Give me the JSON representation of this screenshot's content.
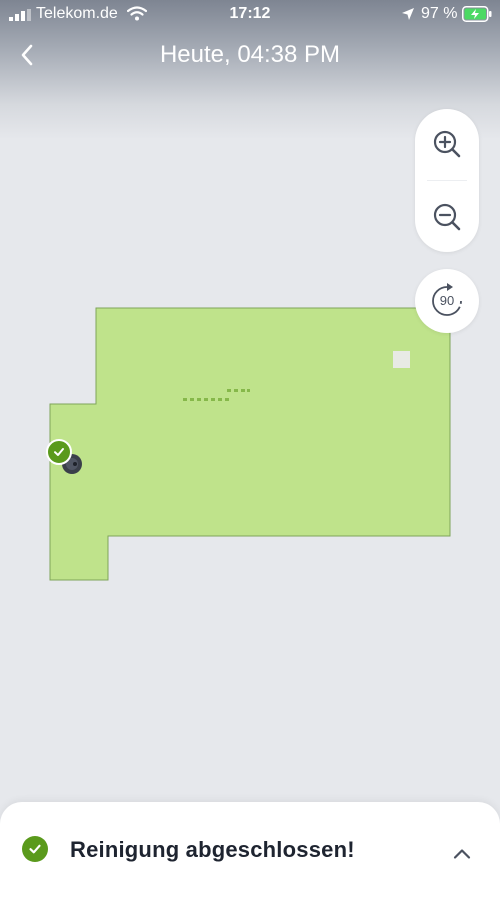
{
  "status_bar": {
    "carrier": "Telekom.de",
    "time": "17:12",
    "battery_percent": "97 %",
    "icons": [
      "signal-icon",
      "wifi-icon",
      "location-icon",
      "battery-charging-icon"
    ]
  },
  "nav": {
    "title": "Heute, 04:38 PM",
    "back_icon": "chevron-left-icon"
  },
  "map_controls": {
    "zoom_in_icon": "zoom-in-icon",
    "zoom_out_icon": "zoom-out-icon",
    "rotate_label": "90",
    "rotate_icon": "rotate-clockwise-icon"
  },
  "map": {
    "cleaned_area_color": "#bfe38b",
    "cleaned_area_border": "#7fa45a",
    "background_color": "#e6e8ec",
    "robot_status_icon": "check-icon",
    "robot_icon": "robot-vacuum-icon",
    "dock_icon": "dock-marker-icon"
  },
  "bottom_sheet": {
    "status_text": "Reinigung abgeschlossen!",
    "status_icon": "check-circle-icon",
    "status_color": "#5a9a1c",
    "expand_icon": "chevron-up-icon"
  }
}
